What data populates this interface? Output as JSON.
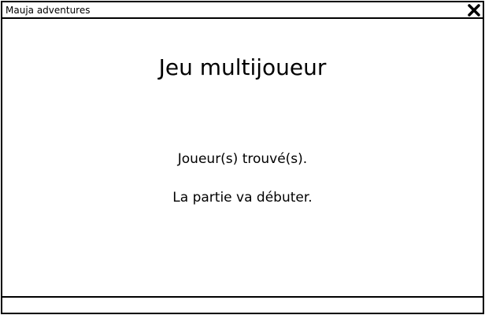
{
  "window": {
    "title": "Mauja adventures",
    "close_icon": "close-icon"
  },
  "main": {
    "heading": "Jeu multijoueur",
    "status_line_1": "Joueur(s) trouvé(s).",
    "status_line_2": "La partie va débuter."
  }
}
